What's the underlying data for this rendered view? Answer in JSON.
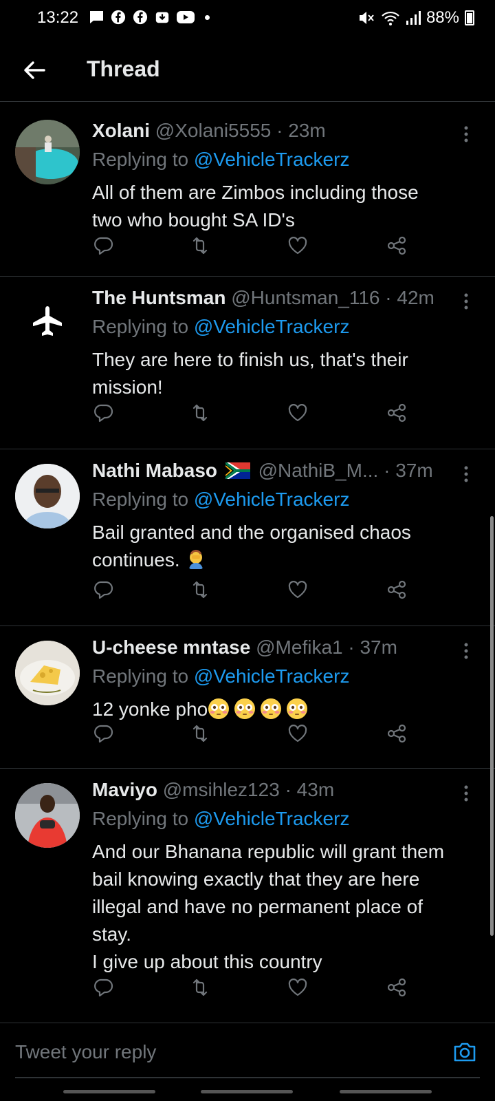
{
  "status_bar": {
    "time": "13:22",
    "battery": "88%",
    "left_icons": [
      "message-icon",
      "facebook-icon",
      "facebook-icon",
      "download-icon",
      "youtube-icon"
    ],
    "right_icons": [
      "mute-icon",
      "wifi-icon",
      "signal-icon",
      "battery-icon"
    ]
  },
  "header": {
    "title": "Thread"
  },
  "replying_label": "Replying to",
  "tweets": [
    {
      "name": "Xolani",
      "handle": "@Xolani5555",
      "time": "23m",
      "mention": "@VehicleTrackerz",
      "lines": [
        "All of them are Zimbos including those",
        "two who bought SA ID's"
      ]
    },
    {
      "name": "The Huntsman",
      "handle": "@Huntsman_116",
      "time": "42m",
      "mention": "@VehicleTrackerz",
      "lines": [
        "They are here to finish us, that's their",
        "mission!"
      ]
    },
    {
      "name": "Nathi Mabaso",
      "handle": "@NathiB_M...",
      "time": "37m",
      "mention": "@VehicleTrackerz",
      "lines": [
        "Bail granted and the organised chaos",
        "continues."
      ]
    },
    {
      "name": "U-cheese mntase",
      "handle": "@Mefika1",
      "time": "37m",
      "mention": "@VehicleTrackerz",
      "lines": [
        "12 yonke pho"
      ]
    },
    {
      "name": "Maviyo",
      "handle": "@msihlez123",
      "time": "43m",
      "mention": "@VehicleTrackerz",
      "lines": [
        "And our Bhanana republic will grant them",
        "bail knowing exactly that they are here",
        "illegal and have no permanent place of",
        "stay.",
        "I give up about this country"
      ]
    }
  ],
  "action_icons": [
    "reply-icon",
    "retweet-icon",
    "like-icon",
    "share-icon"
  ],
  "reply_bar": {
    "placeholder": "Tweet your reply"
  },
  "colors": {
    "accent": "#1d9bf0",
    "background": "#000000",
    "muted": "#71767b",
    "divider": "#2f3336"
  }
}
